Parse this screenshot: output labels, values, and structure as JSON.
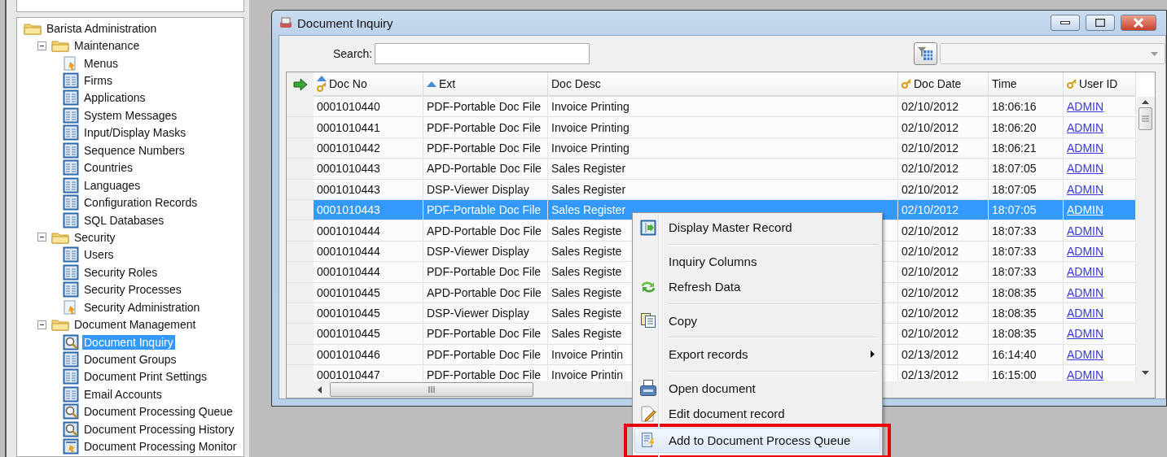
{
  "tree": {
    "label": "Barista Administration",
    "kind": "folder",
    "selected": false,
    "children": [
      {
        "label": "Maintenance",
        "kind": "folder",
        "expanded": true,
        "selected": false,
        "children": [
          {
            "label": "Menus",
            "kind": "menu",
            "selected": false
          },
          {
            "label": "Firms",
            "kind": "table",
            "selected": false
          },
          {
            "label": "Applications",
            "kind": "table",
            "selected": false
          },
          {
            "label": "System Messages",
            "kind": "table",
            "selected": false
          },
          {
            "label": "Input/Display Masks",
            "kind": "table",
            "selected": false
          },
          {
            "label": "Sequence Numbers",
            "kind": "table",
            "selected": false
          },
          {
            "label": "Countries",
            "kind": "table",
            "selected": false
          },
          {
            "label": "Languages",
            "kind": "table",
            "selected": false
          },
          {
            "label": "Configuration Records",
            "kind": "table",
            "selected": false
          },
          {
            "label": "SQL Databases",
            "kind": "table",
            "selected": false
          }
        ]
      },
      {
        "label": "Security",
        "kind": "folder",
        "expanded": true,
        "selected": false,
        "children": [
          {
            "label": "Users",
            "kind": "table",
            "selected": false
          },
          {
            "label": "Security Roles",
            "kind": "table",
            "selected": false
          },
          {
            "label": "Security Processes",
            "kind": "table",
            "selected": false
          },
          {
            "label": "Security Administration",
            "kind": "menu",
            "selected": false
          }
        ]
      },
      {
        "label": "Document Management",
        "kind": "folder",
        "expanded": true,
        "selected": false,
        "children": [
          {
            "label": "Document Inquiry",
            "kind": "search",
            "selected": true
          },
          {
            "label": "Document Groups",
            "kind": "table",
            "selected": false
          },
          {
            "label": "Document Print Settings",
            "kind": "table",
            "selected": false
          },
          {
            "label": "Email Accounts",
            "kind": "table",
            "selected": false
          },
          {
            "label": "Document Processing Queue",
            "kind": "search",
            "selected": false
          },
          {
            "label": "Document Processing History",
            "kind": "search",
            "selected": false
          },
          {
            "label": "Document Processing Monitor",
            "kind": "monitor",
            "selected": false
          }
        ]
      }
    ]
  },
  "window": {
    "title": "Document Inquiry"
  },
  "search": {
    "label": "Search:"
  },
  "table": {
    "columns": [
      {
        "label": "Doc No",
        "sorted": true,
        "key": true,
        "kind": "text"
      },
      {
        "label": "Ext",
        "sorted": true,
        "key": false,
        "kind": "text"
      },
      {
        "label": "Doc Desc",
        "sorted": false,
        "key": false,
        "kind": "text"
      },
      {
        "label": "Doc Date",
        "sorted": false,
        "key": true,
        "kind": "text"
      },
      {
        "label": "Time",
        "sorted": false,
        "key": false,
        "kind": "text"
      },
      {
        "label": "User ID",
        "sorted": false,
        "key": true,
        "kind": "link"
      }
    ],
    "rows": [
      {
        "selected": false,
        "cells": [
          "0001010440",
          "PDF-Portable Doc File",
          "Invoice Printing",
          "02/10/2012",
          "18:06:16",
          "ADMIN"
        ]
      },
      {
        "selected": false,
        "cells": [
          "0001010441",
          "PDF-Portable Doc File",
          "Invoice Printing",
          "02/10/2012",
          "18:06:20",
          "ADMIN"
        ]
      },
      {
        "selected": false,
        "cells": [
          "0001010442",
          "PDF-Portable Doc File",
          "Invoice Printing",
          "02/10/2012",
          "18:06:21",
          "ADMIN"
        ]
      },
      {
        "selected": false,
        "cells": [
          "0001010443",
          "APD-Portable Doc File",
          "Sales Register",
          "02/10/2012",
          "18:07:05",
          "ADMIN"
        ]
      },
      {
        "selected": false,
        "cells": [
          "0001010443",
          "DSP-Viewer Display",
          "Sales Register",
          "02/10/2012",
          "18:07:05",
          "ADMIN"
        ]
      },
      {
        "selected": true,
        "cells": [
          "0001010443",
          "PDF-Portable Doc File",
          "Sales Register",
          "02/10/2012",
          "18:07:05",
          "ADMIN"
        ]
      },
      {
        "selected": false,
        "cells": [
          "0001010444",
          "APD-Portable Doc File",
          "Sales Registe",
          "02/10/2012",
          "18:07:33",
          "ADMIN"
        ]
      },
      {
        "selected": false,
        "cells": [
          "0001010444",
          "DSP-Viewer Display",
          "Sales Registe",
          "02/10/2012",
          "18:07:33",
          "ADMIN"
        ]
      },
      {
        "selected": false,
        "cells": [
          "0001010444",
          "PDF-Portable Doc File",
          "Sales Registe",
          "02/10/2012",
          "18:07:33",
          "ADMIN"
        ]
      },
      {
        "selected": false,
        "cells": [
          "0001010445",
          "APD-Portable Doc File",
          "Sales Registe",
          "02/10/2012",
          "18:08:35",
          "ADMIN"
        ]
      },
      {
        "selected": false,
        "cells": [
          "0001010445",
          "DSP-Viewer Display",
          "Sales Registe",
          "02/10/2012",
          "18:08:35",
          "ADMIN"
        ]
      },
      {
        "selected": false,
        "cells": [
          "0001010445",
          "PDF-Portable Doc File",
          "Sales Registe",
          "02/10/2012",
          "18:08:35",
          "ADMIN"
        ]
      },
      {
        "selected": false,
        "cells": [
          "0001010446",
          "PDF-Portable Doc File",
          "Invoice Printin",
          "02/13/2012",
          "16:14:40",
          "ADMIN"
        ]
      },
      {
        "selected": false,
        "cells": [
          "0001010447",
          "PDF-Portable Doc File",
          "Invoice Printin",
          "02/13/2012",
          "16:15:00",
          "ADMIN"
        ]
      }
    ]
  },
  "context_menu": {
    "items": [
      {
        "kind": "master",
        "label": "Display Master Record",
        "selected": false
      },
      {
        "kind": "separator"
      },
      {
        "kind": "plain",
        "label": "Inquiry Columns",
        "selected": false
      },
      {
        "kind": "refresh",
        "label": "Refresh Data",
        "selected": false
      },
      {
        "kind": "separator"
      },
      {
        "kind": "copy",
        "label": "Copy",
        "selected": false
      },
      {
        "kind": "separator"
      },
      {
        "kind": "submenu",
        "label": "Export records",
        "selected": false
      },
      {
        "kind": "separator"
      },
      {
        "kind": "open",
        "label": "Open document",
        "selected": false
      },
      {
        "kind": "edit",
        "label": "Edit document record",
        "selected": false
      },
      {
        "kind": "queue",
        "label": "Add to Document Process Queue",
        "selected": true
      }
    ]
  }
}
